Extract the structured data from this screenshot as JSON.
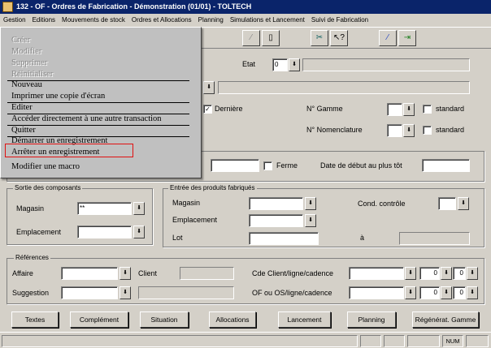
{
  "window": {
    "title": "132 - OF - Ordres de Fabrication - Démonstration (01/01) - TOLTECH"
  },
  "menubar": [
    "Gestion",
    "Editions",
    "Mouvements de stock",
    "Ordres et Allocations",
    "Planning",
    "Simulations et Lancement",
    "Suivi de Fabrication"
  ],
  "context_menu": {
    "items": [
      {
        "label": "Créer",
        "enabled": false
      },
      {
        "label": "Modifier",
        "enabled": false
      },
      {
        "label": "Supprimer",
        "enabled": false
      },
      {
        "label": "Réinitialiser",
        "enabled": false
      },
      {
        "label": "Nouveau",
        "enabled": true
      },
      {
        "label": "Imprimer une copie d'écran",
        "enabled": true
      },
      {
        "label": "Editer",
        "enabled": true
      },
      {
        "label": "Accéder directement à une autre transaction",
        "enabled": true
      },
      {
        "label": "Quitter",
        "enabled": true
      },
      {
        "label": "Démarrer un enregistrement",
        "enabled": true
      },
      {
        "label": "Arrêter un enregistrement",
        "enabled": true,
        "highlighted": true
      },
      {
        "label": "Modifier une macro",
        "enabled": true
      }
    ]
  },
  "header": {
    "etat_label": "Etat",
    "etat_value": "0",
    "derniere_label": "Dernière",
    "derniere_checked": true,
    "gamme_label": "N° Gamme",
    "nomenclature_label": "N° Nomenclature",
    "standard_label": "standard"
  },
  "dates": {
    "ferme_label": "Ferme",
    "debut_label": "Date de début au plus tôt"
  },
  "sortie": {
    "title": "Sortie des composants",
    "magasin_label": "Magasin",
    "magasin_value": "**",
    "emplacement_label": "Emplacement"
  },
  "entree": {
    "title": "Entrée des produits fabriqués",
    "magasin_label": "Magasin",
    "emplacement_label": "Emplacement",
    "lot_label": "Lot",
    "a_label": "à",
    "cond_label": "Cond. contrôle"
  },
  "references": {
    "title": "Références",
    "affaire_label": "Affaire",
    "client_label": "Client",
    "suggestion_label": "Suggestion",
    "cde_label": "Cde Client/ligne/cadence",
    "of_label": "OF ou OS/ligne/cadence",
    "cde_line": "0",
    "cde_cad": "0",
    "of_line": "0",
    "of_cad": "0"
  },
  "buttons": [
    "Textes",
    "Complément",
    "Situation",
    "Allocations",
    "Lancement",
    "Planning",
    "Régénérat. Gamme"
  ],
  "statusbar": {
    "num": "NUM"
  },
  "icons": {
    "dropdown": "dropdown-arrow-icon",
    "app": "app-icon"
  }
}
